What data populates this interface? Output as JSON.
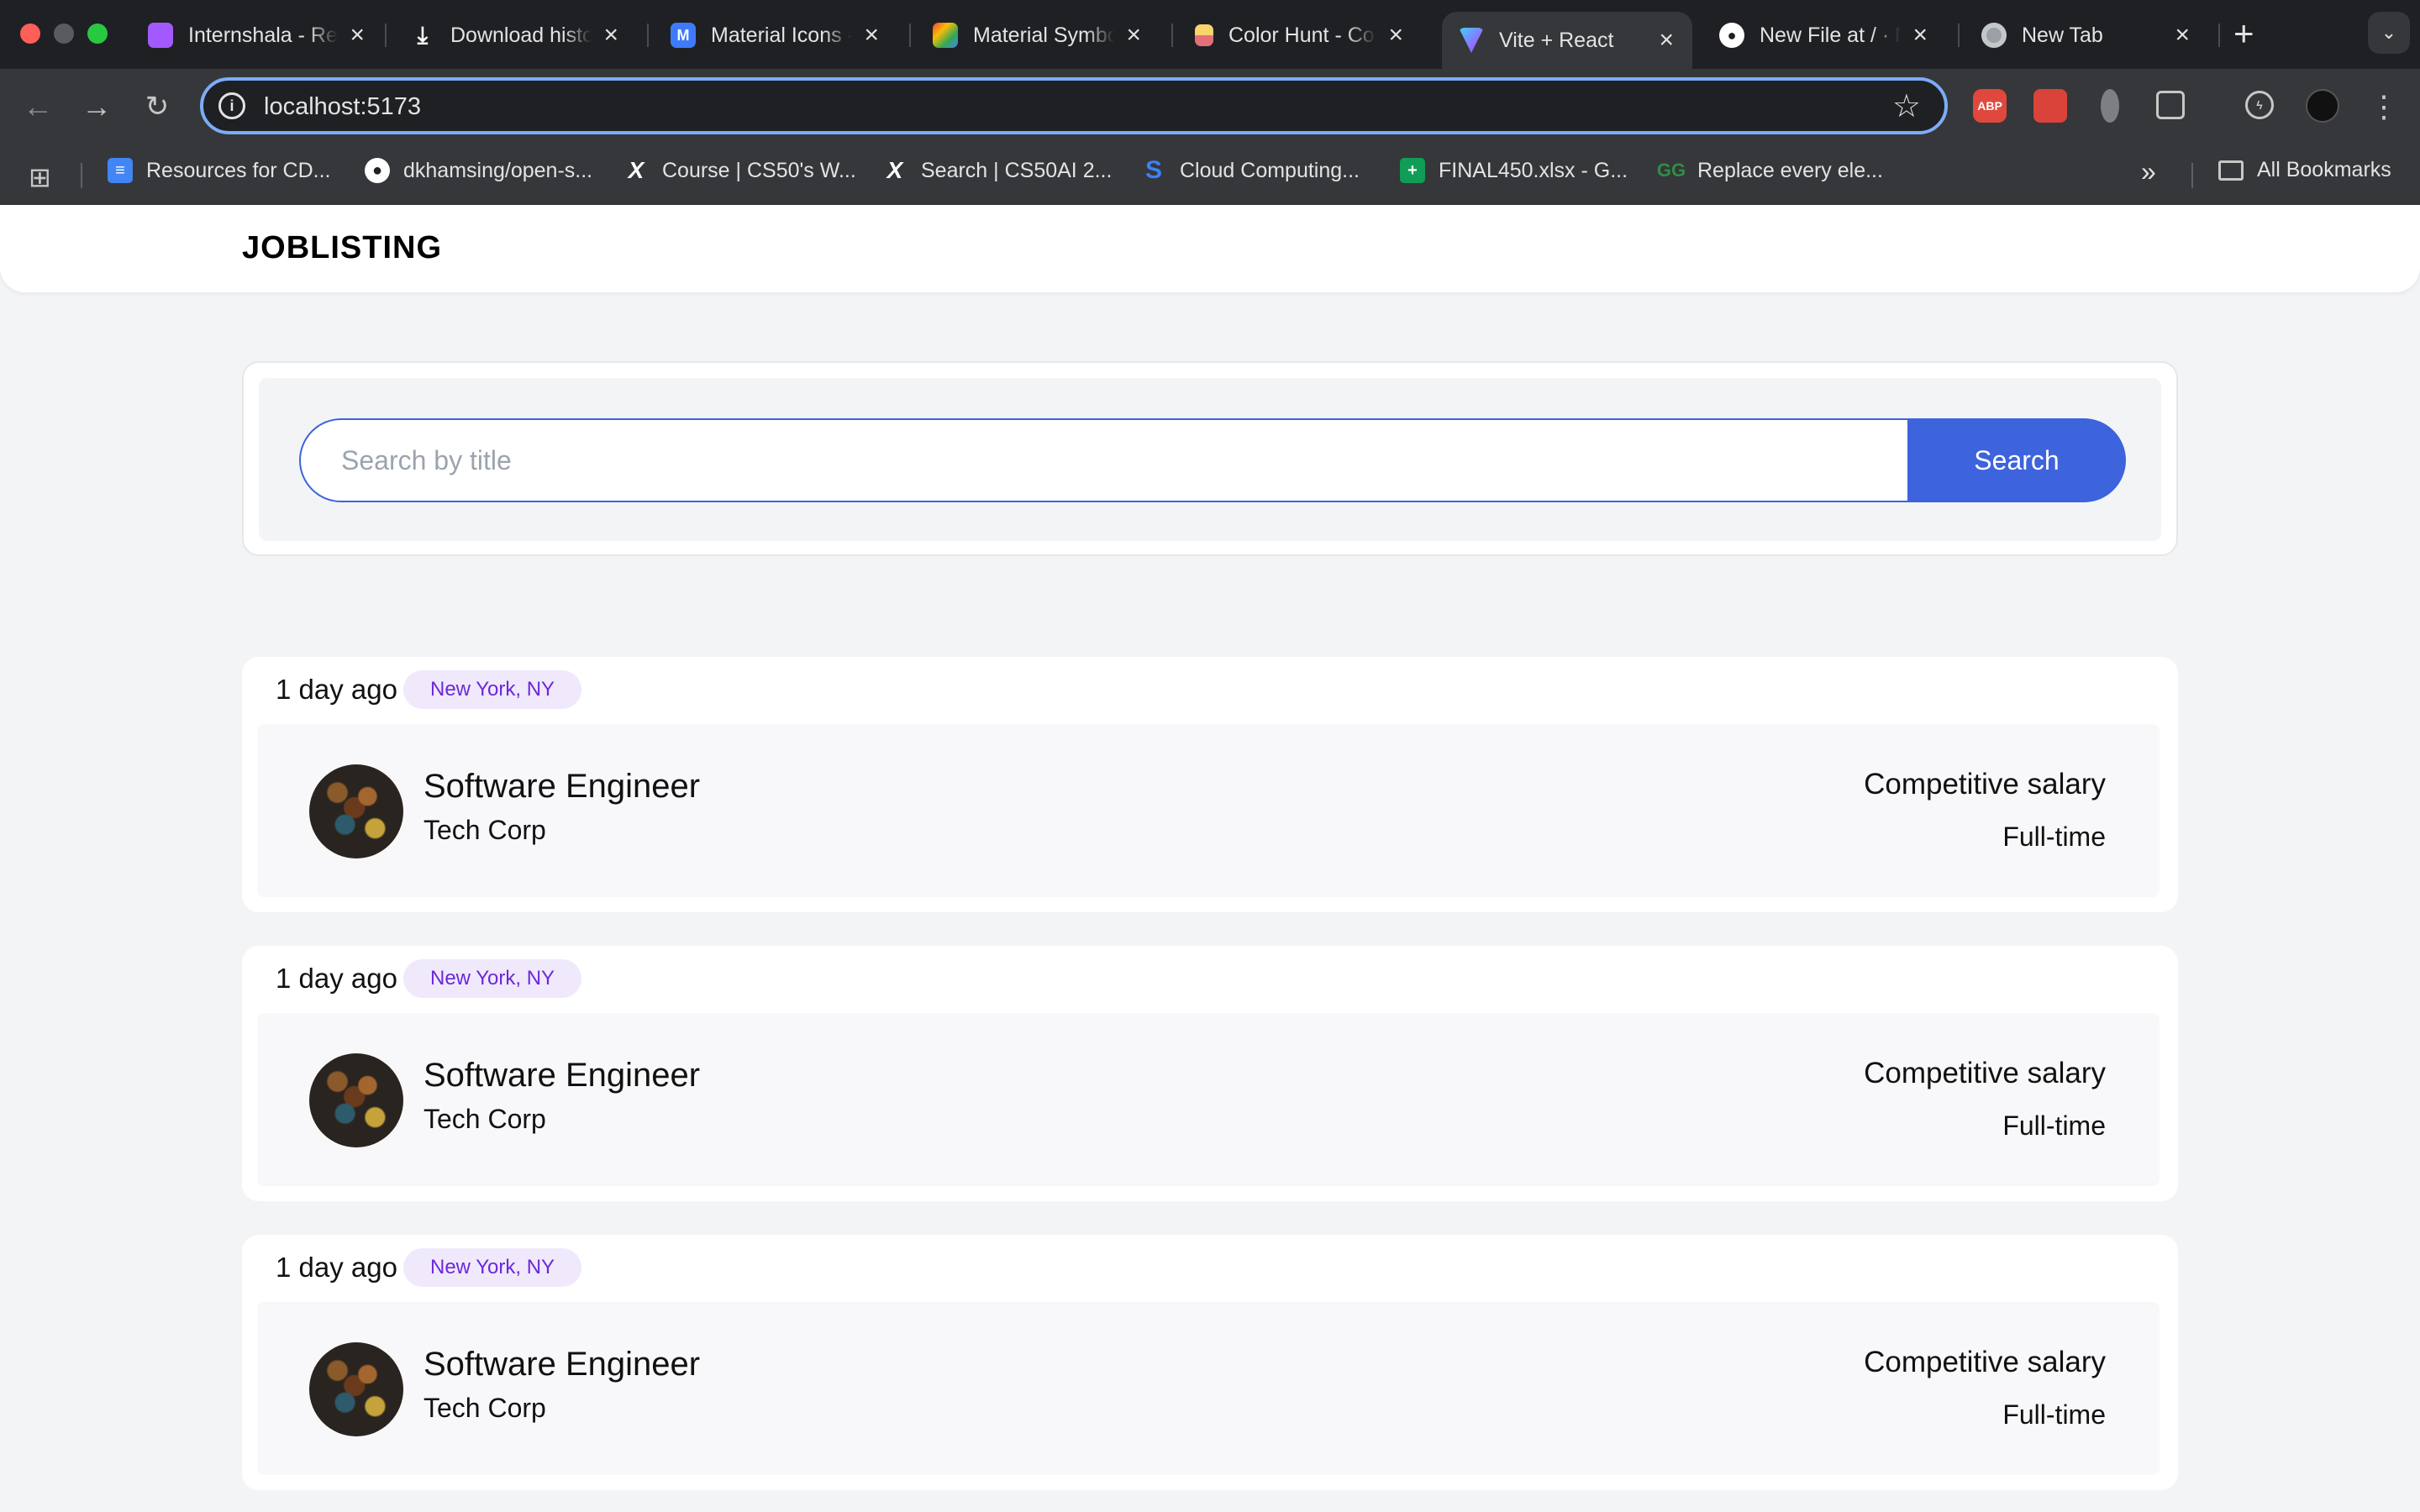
{
  "browser": {
    "tabs": [
      {
        "title": "Internshala - Re",
        "favicon": "figma-icon",
        "color": "#a259ff"
      },
      {
        "title": "Download histo",
        "favicon": "download-icon",
        "color": "#1f2023"
      },
      {
        "title": "Material Icons -",
        "favicon": "material-icons-icon",
        "color": "#3d7bfa"
      },
      {
        "title": "Material Symbo",
        "favicon": "material-symbols-icon",
        "color": "#4285f4"
      },
      {
        "title": "Color Hunt - Co",
        "favicon": "color-hunt-icon",
        "color": "#f4c542"
      },
      {
        "title": "Vite + React",
        "favicon": "vite-icon",
        "color": "#a855f7",
        "active": true
      },
      {
        "title": "New File at / · N",
        "favicon": "github-icon",
        "color": "#ffffff"
      },
      {
        "title": "New Tab",
        "favicon": "chrome-icon",
        "color": "#9aa0a6"
      }
    ],
    "new_tab": "+",
    "url": "localhost:5173",
    "bookmarks": [
      {
        "label": "Resources for CD...",
        "icon": "google-docs-icon",
        "color": "#4285f4"
      },
      {
        "label": "dkhamsing/open-s...",
        "icon": "github-icon",
        "color": "#ffffff"
      },
      {
        "label": "Course | CS50's W...",
        "icon": "edx-icon",
        "color": "#ffffff"
      },
      {
        "label": "Search | CS50AI 2...",
        "icon": "edx-icon",
        "color": "#ffffff"
      },
      {
        "label": "Cloud Computing...",
        "icon": "s-icon",
        "color": "#3b82f6"
      },
      {
        "label": "FINAL450.xlsx - G...",
        "icon": "google-sheets-icon",
        "color": "#0f9d58"
      },
      {
        "label": "Replace every ele...",
        "icon": "geeksforgeeks-icon",
        "color": "#2f8d46"
      }
    ],
    "all_bookmarks": "All Bookmarks",
    "extensions": [
      {
        "name": "adblock-plus-icon",
        "label": "ABP",
        "color": "#e0483e"
      },
      {
        "name": "extension-red-icon",
        "label": "",
        "color": "#d9433a"
      },
      {
        "name": "extension-gray-icon",
        "label": "",
        "color": "#7d7f83"
      },
      {
        "name": "puzzle-icon",
        "label": "",
        "color": "#36373a"
      },
      {
        "name": "performance-icon",
        "label": "",
        "color": "#36373a"
      },
      {
        "name": "profile-avatar-icon",
        "label": "",
        "color": "#111111"
      }
    ]
  },
  "app": {
    "brand": "JOBLISTING",
    "search": {
      "placeholder": "Search by title",
      "value": "",
      "button": "Search"
    },
    "jobs": [
      {
        "posted": "1 day ago",
        "location": "New York, NY",
        "title": "Software Engineer",
        "company": "Tech Corp",
        "salary": "Competitive salary",
        "type": "Full-time"
      },
      {
        "posted": "1 day ago",
        "location": "New York, NY",
        "title": "Software Engineer",
        "company": "Tech Corp",
        "salary": "Competitive salary",
        "type": "Full-time"
      },
      {
        "posted": "1 day ago",
        "location": "New York, NY",
        "title": "Software Engineer",
        "company": "Tech Corp",
        "salary": "Competitive salary",
        "type": "Full-time"
      }
    ]
  }
}
